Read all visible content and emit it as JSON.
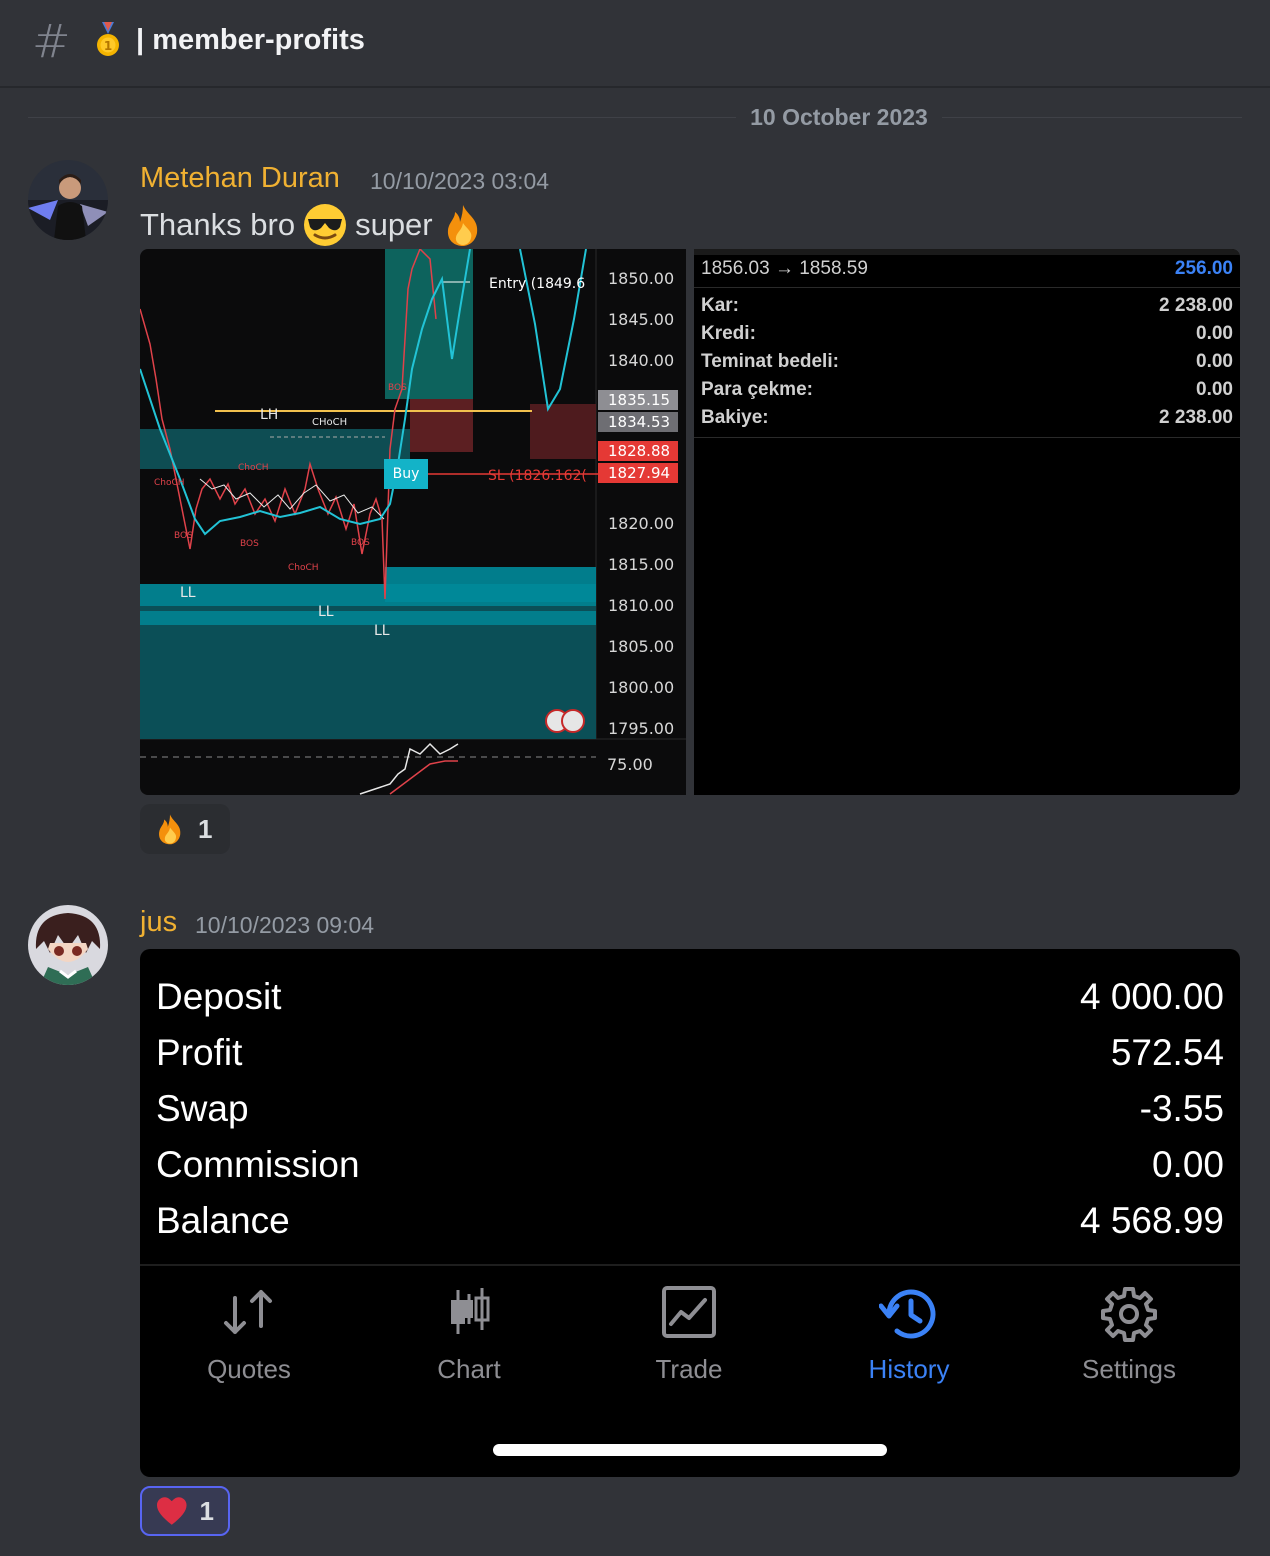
{
  "channel": {
    "name": "member-profits",
    "icon": "hash-icon",
    "emoji": "medal-emoji",
    "separator": "|"
  },
  "divider": {
    "date": "10 October 2023"
  },
  "messages": [
    {
      "author": "Metehan Duran",
      "timestamp": "10/10/2023 03:04",
      "text": {
        "part1": "Thanks bro",
        "emoji1": "sunglasses-emoji",
        "part2": "super",
        "emoji2": "fire-emoji"
      },
      "chart_image": {
        "price_labels": [
          "1850.00",
          "1845.00",
          "1840.00",
          "1820.00",
          "1815.00",
          "1810.00",
          "1805.00",
          "1800.00",
          "1795.00"
        ],
        "tags": {
          "t1": "1835.15",
          "t2": "1834.53",
          "t3": "1828.88",
          "t4": "1827.94"
        },
        "indicator_label": "75.00",
        "entry_label": "Entry (1849.6",
        "sl_label": "SL (1826.162(",
        "buy_label": "Buy",
        "annotations": {
          "lh": "LH",
          "choch": "CHoCH",
          "ll1": "LL",
          "ll2": "LL",
          "ll3": "LL",
          "choch2": "ChoCH",
          "choch3": "ChoCH",
          "choch4": "ChoCH",
          "bos1": "BOS",
          "bos2": "BOS",
          "bos3": "BOS",
          "bos4": "BOS"
        }
      },
      "account_image": {
        "price_move": "1856.03 → 1858.59",
        "price_profit": "256.00",
        "rows": [
          {
            "label": "Kar:",
            "value": "2 238.00"
          },
          {
            "label": "Kredi:",
            "value": "0.00"
          },
          {
            "label": "Teminat bedeli:",
            "value": "0.00"
          },
          {
            "label": "Para çekme:",
            "value": "0.00"
          },
          {
            "label": "Bakiye:",
            "value": "2 238.00"
          }
        ]
      },
      "reaction": {
        "emoji": "fire-emoji",
        "count": "1"
      }
    },
    {
      "author": "jus",
      "timestamp": "10/10/2023 09:04",
      "summary": [
        {
          "label": "Deposit",
          "value": "4 000.00"
        },
        {
          "label": "Profit",
          "value": "572.54"
        },
        {
          "label": "Swap",
          "value": "-3.55"
        },
        {
          "label": "Commission",
          "value": "0.00"
        },
        {
          "label": "Balance",
          "value": "4 568.99"
        }
      ],
      "tabs": [
        {
          "label": "Quotes",
          "icon": "quotes-arrows-icon"
        },
        {
          "label": "Chart",
          "icon": "candles-icon"
        },
        {
          "label": "Trade",
          "icon": "trade-chart-icon"
        },
        {
          "label": "History",
          "icon": "history-clock-icon",
          "active": true
        },
        {
          "label": "Settings",
          "icon": "gear-icon"
        }
      ],
      "reaction": {
        "emoji": "heart-emoji",
        "count": "1"
      }
    }
  ],
  "colors": {
    "author": "#f0b132",
    "active_tab": "#3b82f6",
    "tab": "#8e8e93",
    "profit_blue": "#3b82f6",
    "sl_red": "#e53935",
    "teal": "#009aa8"
  }
}
